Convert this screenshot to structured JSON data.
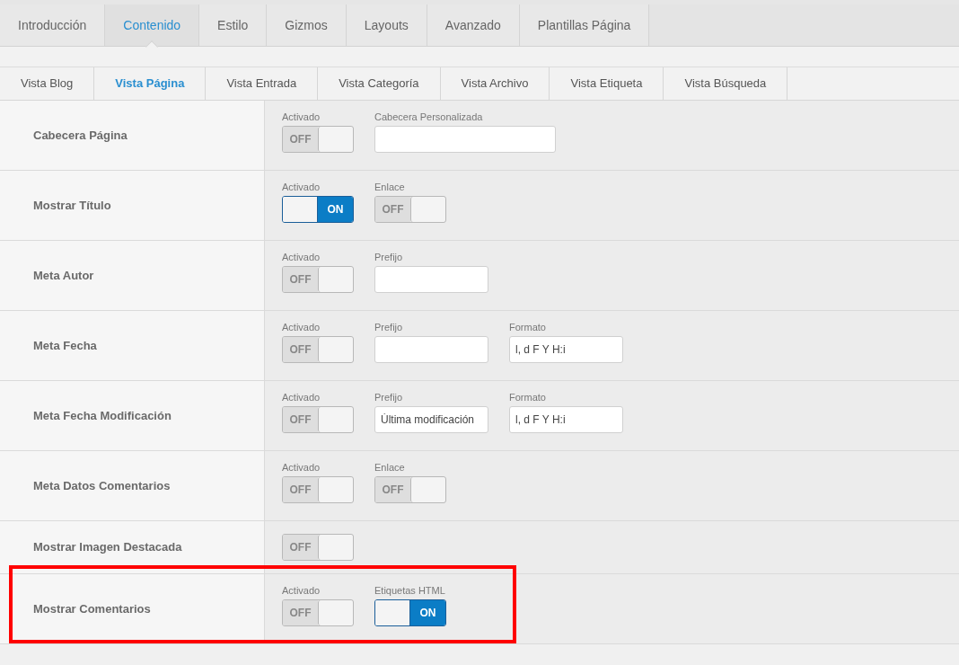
{
  "tabs": [
    {
      "label": "Introducción",
      "selected": false
    },
    {
      "label": "Contenido",
      "selected": true
    },
    {
      "label": "Estilo",
      "selected": false
    },
    {
      "label": "Gizmos",
      "selected": false
    },
    {
      "label": "Layouts",
      "selected": false
    },
    {
      "label": "Avanzado",
      "selected": false
    },
    {
      "label": "Plantillas Página",
      "selected": false
    }
  ],
  "subtabs": [
    {
      "label": "Vista Blog",
      "selected": false
    },
    {
      "label": "Vista Página",
      "selected": true
    },
    {
      "label": "Vista Entrada",
      "selected": false
    },
    {
      "label": "Vista Categoría",
      "selected": false
    },
    {
      "label": "Vista Archivo",
      "selected": false
    },
    {
      "label": "Vista Etiqueta",
      "selected": false
    },
    {
      "label": "Vista Búsqueda",
      "selected": false
    }
  ],
  "rows": [
    {
      "label": "Cabecera Página",
      "highlighted": false,
      "controls": [
        {
          "kind": "toggle",
          "label": "Activado",
          "on": false,
          "text": "OFF"
        },
        {
          "kind": "widetext",
          "label": "Cabecera Personalizada"
        }
      ]
    },
    {
      "label": "Mostrar Título",
      "highlighted": false,
      "controls": [
        {
          "kind": "toggle",
          "label": "Activado",
          "on": true,
          "text": "ON"
        },
        {
          "kind": "toggle",
          "label": "Enlace",
          "on": false,
          "text": "OFF"
        }
      ]
    },
    {
      "label": "Meta Autor",
      "highlighted": false,
      "controls": [
        {
          "kind": "toggle",
          "label": "Activado",
          "on": false,
          "text": "OFF"
        },
        {
          "kind": "text",
          "label": "Prefijo"
        }
      ]
    },
    {
      "label": "Meta Fecha",
      "highlighted": false,
      "controls": [
        {
          "kind": "toggle",
          "label": "Activado",
          "on": false,
          "text": "OFF"
        },
        {
          "kind": "text",
          "label": "Prefijo"
        },
        {
          "kind": "text",
          "label": "Formato",
          "value": "l, d F Y H:i"
        }
      ]
    },
    {
      "label": "Meta Fecha Modificación",
      "highlighted": false,
      "controls": [
        {
          "kind": "toggle",
          "label": "Activado",
          "on": false,
          "text": "OFF"
        },
        {
          "kind": "text",
          "label": "Prefijo",
          "value": "Última modificación"
        },
        {
          "kind": "text",
          "label": "Formato",
          "value": "l, d F Y H:i"
        }
      ]
    },
    {
      "label": "Meta Datos Comentarios",
      "highlighted": false,
      "controls": [
        {
          "kind": "toggle",
          "label": "Activado",
          "on": false,
          "text": "OFF"
        },
        {
          "kind": "toggle",
          "label": "Enlace",
          "on": false,
          "text": "OFF"
        }
      ]
    },
    {
      "label": "Mostrar Imagen Destacada",
      "highlighted": false,
      "controls": [
        {
          "kind": "toggle",
          "on": false,
          "text": "OFF"
        }
      ]
    },
    {
      "label": "Mostrar Comentarios",
      "highlighted": true,
      "controls": [
        {
          "kind": "toggle",
          "label": "Activado",
          "on": false,
          "text": "OFF"
        },
        {
          "kind": "toggle",
          "label": "Etiquetas HTML",
          "on": true,
          "text": "ON"
        }
      ]
    }
  ]
}
